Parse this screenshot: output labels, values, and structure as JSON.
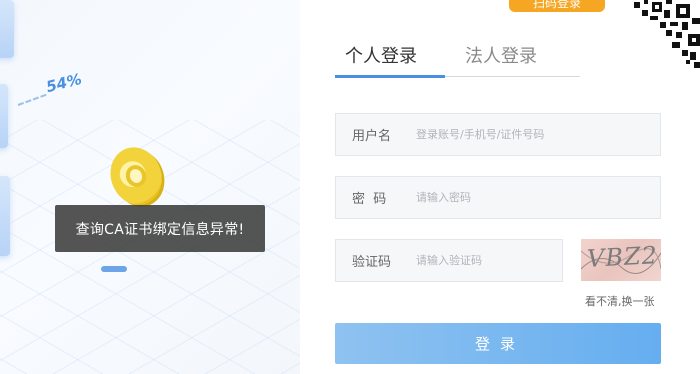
{
  "illustration": {
    "progress_text": "54%"
  },
  "toast": {
    "message": "查询CA证书绑定信息异常!"
  },
  "scan_login": {
    "label": "扫码登录"
  },
  "tabs": [
    {
      "label": "个人登录",
      "active": true
    },
    {
      "label": "法人登录",
      "active": false
    }
  ],
  "form": {
    "username": {
      "label": "用户名",
      "placeholder": "登录账号/手机号/证件号码",
      "value": ""
    },
    "password": {
      "label": "密  码",
      "placeholder": "请输入密码",
      "value": ""
    },
    "captcha": {
      "label": "验证码",
      "placeholder": "请输入验证码",
      "value": "",
      "image_text": "VBZ2"
    },
    "refresh_text": "看不清,换一张",
    "submit_label": "登录"
  },
  "colors": {
    "accent": "#4a90e2",
    "scan_tag": "#f5a623",
    "button_start": "#8fc2f0",
    "button_end": "#65aef0",
    "toast_bg": "#3c3c3c"
  },
  "icons": {
    "qr": "qr-code-icon"
  }
}
